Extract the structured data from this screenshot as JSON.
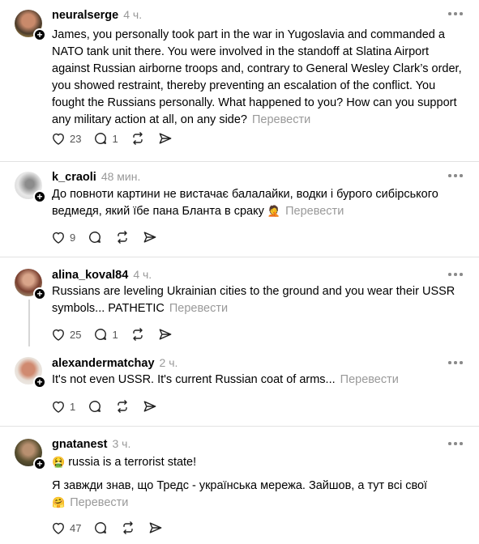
{
  "posts": [
    {
      "username": "neuralserge",
      "time": "4 ч.",
      "text": "James, you personally took part in the war in Yugoslavia and commanded a NATO tank unit there. You were involved in the standoff at Slatina Airport against Russian airborne troops and, contrary to General Wesley Clark’s order, you showed restraint, thereby preventing an escalation of the conflict. You fought the Russians personally. What happened to you? How can you support any military action at all, on any side?",
      "translate": "Перевести",
      "likes": "23",
      "replies": "1"
    },
    {
      "username": "k_craoli",
      "time": "48 мин.",
      "text": "До повноти картини не вистачає балалайки, водки і бурого сибірського ведмедя, який їбе пана Бланта в сраку",
      "emoji": "🤦",
      "translate": "Перевести",
      "likes": "9",
      "replies": ""
    },
    {
      "username": "alina_koval84",
      "time": "4 ч.",
      "text": "Russians are leveling Ukrainian cities to the ground and you wear their USSR symbols... PATHETIC",
      "translate": "Перевести",
      "likes": "25",
      "replies": "1"
    },
    {
      "username": "alexandermatchay",
      "time": "2 ч.",
      "text": "It's not even USSR. It's current Russian coat of arms...",
      "translate": "Перевести",
      "likes": "1",
      "replies": ""
    },
    {
      "username": "gnatanest",
      "time": "3 ч.",
      "emoji_lead": "🤮",
      "text": "russia is a terrorist state!",
      "text2": "Я завжди знав, що Тредс - українська мережа. Зайшов, а тут всі свої",
      "emoji2": "🤗",
      "translate": "Перевести",
      "likes": "47",
      "replies": ""
    }
  ]
}
